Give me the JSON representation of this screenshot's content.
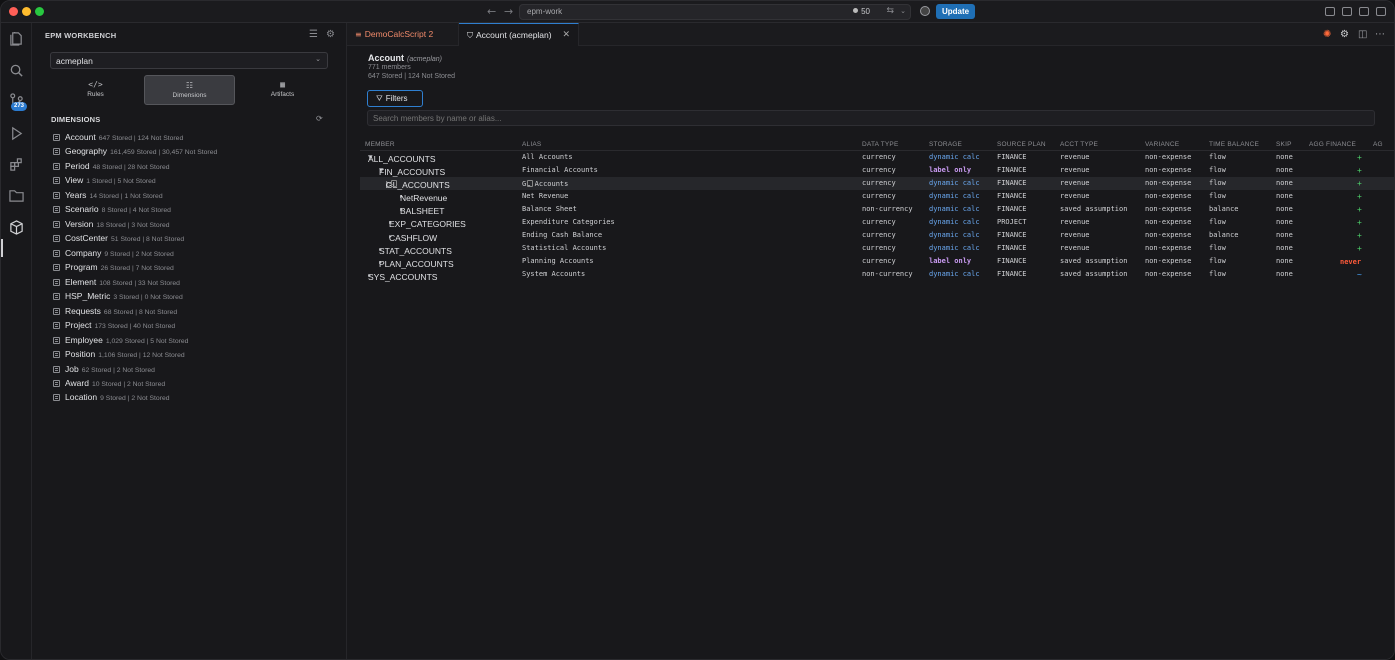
{
  "titlebar": {
    "command_center": "epm-work",
    "count": "50",
    "update_label": "Update"
  },
  "activity": {
    "badge": "273"
  },
  "sidebar": {
    "title": "EPM WORKBENCH",
    "app_selected": "acmeplan",
    "modes": [
      {
        "label": "Rules",
        "icon": "code-icon"
      },
      {
        "label": "Dimensions",
        "icon": "dimensions-icon",
        "active": true
      },
      {
        "label": "Artifacts",
        "icon": "artifacts-icon"
      }
    ],
    "dimensions_header": "DIMENSIONS",
    "dimensions": [
      {
        "name": "Account",
        "stats": "647 Stored | 124 Not Stored"
      },
      {
        "name": "Geography",
        "stats": "161,459 Stored | 30,457 Not Stored"
      },
      {
        "name": "Period",
        "stats": "48 Stored | 28 Not Stored"
      },
      {
        "name": "View",
        "stats": "1 Stored | 5 Not Stored"
      },
      {
        "name": "Years",
        "stats": "14 Stored | 1 Not Stored"
      },
      {
        "name": "Scenario",
        "stats": "8 Stored | 4 Not Stored"
      },
      {
        "name": "Version",
        "stats": "18 Stored | 3 Not Stored"
      },
      {
        "name": "CostCenter",
        "stats": "51 Stored | 8 Not Stored"
      },
      {
        "name": "Company",
        "stats": "9 Stored | 2 Not Stored"
      },
      {
        "name": "Program",
        "stats": "26 Stored | 7 Not Stored"
      },
      {
        "name": "Element",
        "stats": "108 Stored | 33 Not Stored"
      },
      {
        "name": "HSP_Metric",
        "stats": "3 Stored | 0 Not Stored"
      },
      {
        "name": "Requests",
        "stats": "68 Stored | 8 Not Stored"
      },
      {
        "name": "Project",
        "stats": "173 Stored | 40 Not Stored"
      },
      {
        "name": "Employee",
        "stats": "1,029 Stored | 5 Not Stored"
      },
      {
        "name": "Position",
        "stats": "1,106 Stored | 12 Not Stored"
      },
      {
        "name": "Job",
        "stats": "62 Stored | 2 Not Stored"
      },
      {
        "name": "Award",
        "stats": "10 Stored | 2 Not Stored"
      },
      {
        "name": "Location",
        "stats": "9 Stored | 2 Not Stored"
      }
    ]
  },
  "tabs": [
    {
      "label": "DemoCalcScript 2"
    },
    {
      "label": "Account (acmeplan)"
    }
  ],
  "account": {
    "title": "Account",
    "app": "(acmeplan)",
    "members": "771 members",
    "stored": "647 Stored | 124 Not Stored",
    "filters_label": "Filters",
    "search_placeholder": "Search members by name or alias..."
  },
  "grid": {
    "columns": [
      "MEMBER",
      "ALIAS",
      "DATA TYPE",
      "STORAGE",
      "SOURCE PLAN",
      "ACCT TYPE",
      "VARIANCE",
      "TIME BALANCE",
      "SKIP",
      "AGG FINANCE",
      "AG"
    ],
    "rows": [
      {
        "member": "ALL_ACCOUNTS",
        "caret": "▼",
        "alias": "All Accounts",
        "data_type": "currency",
        "storage": "dynamic calc",
        "source_plan": "FINANCE",
        "acct_type": "revenue",
        "variance": "non-expense",
        "time_balance": "flow",
        "skip": "none",
        "agg": "+"
      },
      {
        "member": "FIN_ACCOUNTS",
        "caret": "▼",
        "alias": "Financial Accounts",
        "data_type": "currency",
        "storage": "label only",
        "source_plan": "FINANCE",
        "acct_type": "revenue",
        "variance": "non-expense",
        "time_balance": "flow",
        "skip": "none",
        "agg": "+"
      },
      {
        "member": "GL_ACCOUNTS",
        "caret": "▷",
        "alias": "GL Accounts",
        "data_type": "currency",
        "storage": "dynamic calc",
        "source_plan": "FINANCE",
        "acct_type": "revenue",
        "variance": "non-expense",
        "time_balance": "flow",
        "skip": "none",
        "agg": "+"
      },
      {
        "member": "NetRevenue",
        "caret": "▸",
        "alias": "Net Revenue",
        "data_type": "currency",
        "storage": "dynamic calc",
        "source_plan": "FINANCE",
        "acct_type": "revenue",
        "variance": "non-expense",
        "time_balance": "flow",
        "skip": "none",
        "agg": "+"
      },
      {
        "member": "BALSHEET",
        "caret": "▸",
        "alias": "Balance Sheet",
        "data_type": "non-currency",
        "storage": "dynamic calc",
        "source_plan": "FINANCE",
        "acct_type": "saved assumption",
        "variance": "non-expense",
        "time_balance": "balance",
        "skip": "none",
        "agg": "+"
      },
      {
        "member": "EXP_CATEGORIES",
        "caret": "▸",
        "alias": "Expenditure Categories",
        "data_type": "currency",
        "storage": "dynamic calc",
        "source_plan": "PROJECT",
        "acct_type": "revenue",
        "variance": "non-expense",
        "time_balance": "flow",
        "skip": "none",
        "agg": "+"
      },
      {
        "member": "CASHFLOW",
        "caret": "▸",
        "alias": "Ending Cash Balance",
        "data_type": "currency",
        "storage": "dynamic calc",
        "source_plan": "FINANCE",
        "acct_type": "revenue",
        "variance": "non-expense",
        "time_balance": "balance",
        "skip": "none",
        "agg": "+"
      },
      {
        "member": "STAT_ACCOUNTS",
        "caret": "▸",
        "alias": "Statistical Accounts",
        "data_type": "currency",
        "storage": "dynamic calc",
        "source_plan": "FINANCE",
        "acct_type": "revenue",
        "variance": "non-expense",
        "time_balance": "flow",
        "skip": "none",
        "agg": "+"
      },
      {
        "member": "PLAN_ACCOUNTS",
        "caret": "▸",
        "alias": "Planning Accounts",
        "data_type": "currency",
        "storage": "label only",
        "source_plan": "FINANCE",
        "acct_type": "saved assumption",
        "variance": "non-expense",
        "time_balance": "flow",
        "skip": "none",
        "agg": "never"
      },
      {
        "member": "SYS_ACCOUNTS",
        "caret": "▸",
        "alias": "System Accounts",
        "data_type": "non-currency",
        "storage": "dynamic calc",
        "source_plan": "FINANCE",
        "acct_type": "saved assumption",
        "variance": "non-expense",
        "time_balance": "flow",
        "skip": "none",
        "agg": "~"
      }
    ]
  }
}
